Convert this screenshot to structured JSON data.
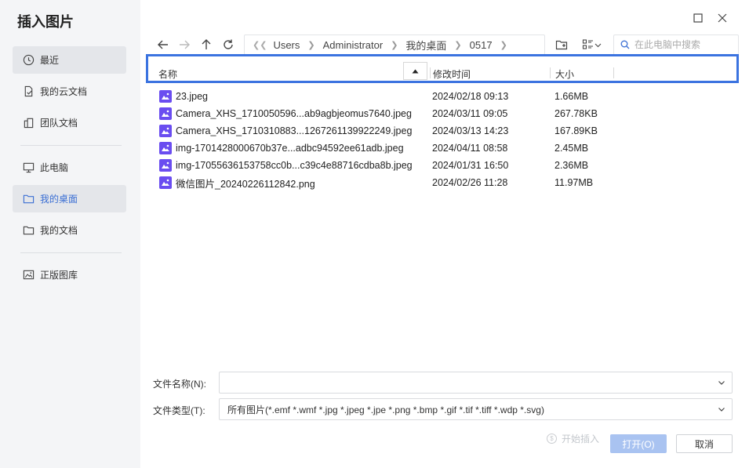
{
  "app_title": "插入图片",
  "sidebar": {
    "items": [
      {
        "label": "最近",
        "icon": "clock-icon"
      },
      {
        "label": "我的云文档",
        "icon": "cloud-doc-icon"
      },
      {
        "label": "团队文档",
        "icon": "team-doc-icon"
      },
      {
        "label": "此电脑",
        "icon": "computer-icon"
      },
      {
        "label": "我的桌面",
        "icon": "folder-icon"
      },
      {
        "label": "我的文档",
        "icon": "folder-icon"
      },
      {
        "label": "正版图库",
        "icon": "gallery-icon"
      }
    ]
  },
  "path": {
    "crumbs": [
      "Users",
      "Administrator",
      "我的桌面",
      "0517"
    ]
  },
  "search": {
    "placeholder": "在此电脑中搜索"
  },
  "columns": {
    "name": "名称",
    "modified": "修改时间",
    "size": "大小"
  },
  "files": [
    {
      "name": "23.jpeg",
      "date": "2024/02/18 09:13",
      "size": "1.66MB"
    },
    {
      "name": "Camera_XHS_1710050596...ab9agbjeomus7640.jpeg",
      "date": "2024/03/11 09:05",
      "size": "267.78KB"
    },
    {
      "name": "Camera_XHS_1710310883...1267261139922249.jpeg",
      "date": "2024/03/13 14:23",
      "size": "167.89KB"
    },
    {
      "name": "img-1701428000670b37e...adbc94592ee61adb.jpeg",
      "date": "2024/04/11 08:58",
      "size": "2.45MB"
    },
    {
      "name": "img-17055636153758cc0b...c39c4e88716cdba8b.jpeg",
      "date": "2024/01/31 16:50",
      "size": "2.36MB"
    },
    {
      "name": "微信图片_20240226112842.png",
      "date": "2024/02/26 11:28",
      "size": "11.97MB"
    }
  ],
  "form": {
    "filename_label": "文件名称(N):",
    "filename_value": "",
    "filetype_label": "文件类型(T):",
    "filetype_value": "所有图片(*.emf *.wmf *.jpg *.jpeg *.jpe *.png *.bmp *.gif *.tif *.tiff *.wdp *.svg)"
  },
  "buttons": {
    "start_insert": "开始插入",
    "open": "打开(O)",
    "cancel": "取消"
  },
  "colors": {
    "accent": "#3b73e0",
    "file_icon": "#6a4df0",
    "open_disabled": "#a9c3f1"
  }
}
